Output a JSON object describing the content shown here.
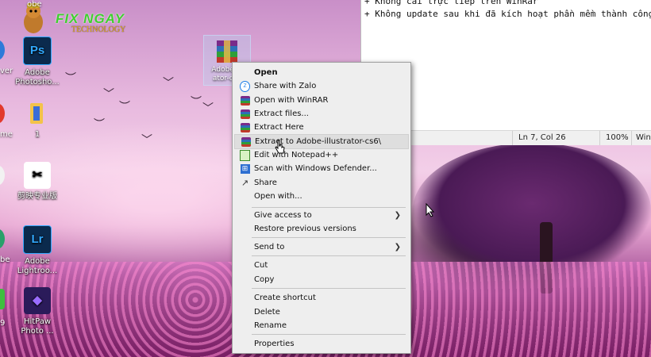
{
  "desktop": {
    "logo": {
      "title": "FIX NGAY",
      "subtitle": "TECHNOLOGY"
    },
    "icons": [
      {
        "name": "ps-icon",
        "glyph": "Ps",
        "label": "Adobe Photosho...",
        "bg": "#0b2a4d",
        "fg": "#31a8ff"
      },
      {
        "name": "capcut-icon",
        "glyph": "✂",
        "label": "剪映专业版",
        "bg": "#ffffff",
        "fg": "#000000"
      },
      {
        "name": "lr-icon",
        "glyph": "Lr",
        "label": "Adobe Lightroo...",
        "bg": "#0b2a4d",
        "fg": "#31a8ff"
      },
      {
        "name": "hitpaw-icon",
        "glyph": "◆",
        "label": "HitPaw Photo ...",
        "bg": "#2b1b5a",
        "fg": "#9a6cff"
      },
      {
        "name": "folder-icon",
        "glyph": "▮",
        "label": "1",
        "bg": "#f3c34a",
        "fg": "#3b6dd8"
      },
      {
        "name": "rar-file-icon",
        "glyph": "",
        "label": "Adobe-ill ator-cs6",
        "bg": "#7a2b8a",
        "fg": "#fff"
      }
    ],
    "edge_labels": [
      "obe",
      "ver",
      "me",
      "be",
      "9"
    ]
  },
  "notepad": {
    "lines": [
      "+ Không cài trực tiếp trên WinRar",
      "+ Không update sau khi đã kích hoạt phần mềm thành công."
    ],
    "status": {
      "position": "Ln 7, Col 26",
      "zoom": "100%",
      "encoding": "Win"
    }
  },
  "context_menu": {
    "items": [
      {
        "label": "Open",
        "bold": true
      },
      {
        "label": "Share with Zalo",
        "icon": "zalo"
      },
      {
        "label": "Open with WinRAR",
        "icon": "rar"
      },
      {
        "label": "Extract files...",
        "icon": "rar"
      },
      {
        "label": "Extract Here",
        "icon": "rar"
      },
      {
        "label": "Extract to Adobe-illustrator-cs6\\",
        "icon": "rar",
        "hover": true
      },
      {
        "label": "Edit with Notepad++",
        "icon": "notepad"
      },
      {
        "label": "Scan with Windows Defender...",
        "icon": "defender"
      },
      {
        "label": "Share",
        "icon": "share"
      },
      {
        "label": "Open with..."
      },
      {
        "label": "Give access to",
        "submenu": true
      },
      {
        "label": "Restore previous versions"
      },
      {
        "label": "Send to",
        "submenu": true
      },
      {
        "label": "Cut"
      },
      {
        "label": "Copy"
      },
      {
        "label": "Create shortcut"
      },
      {
        "label": "Delete"
      },
      {
        "label": "Rename"
      },
      {
        "label": "Properties"
      }
    ]
  },
  "colors": {
    "menu_bg": "#eeeeee",
    "hover_bg": "#dedede",
    "logo_green": "#3fcf2f"
  }
}
